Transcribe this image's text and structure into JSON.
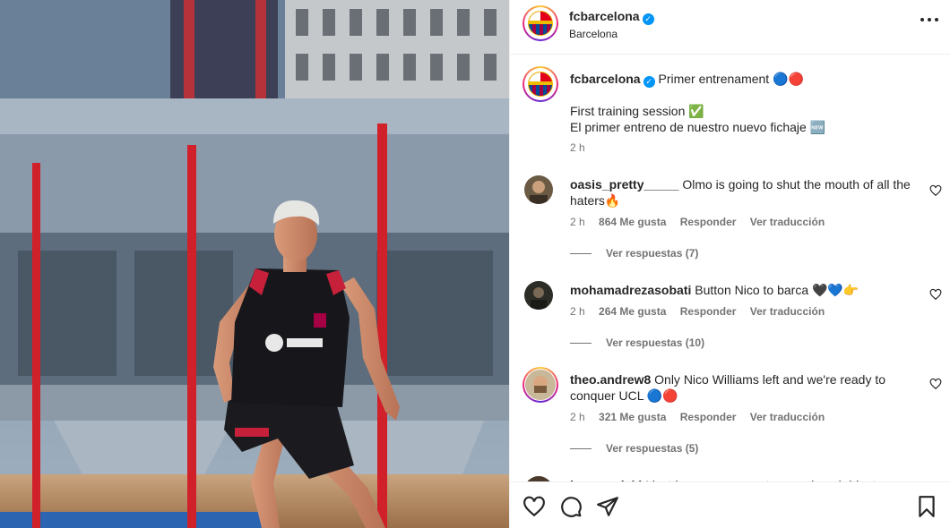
{
  "post": {
    "account": "fcbarcelona",
    "verified_mark": "✓",
    "location": "Barcelona",
    "photo_subject": "player-training-photo"
  },
  "caption": {
    "username": "fcbarcelona",
    "title": "Primer entrenament 🔵🔴",
    "line1": "First training session ✅",
    "line2": "El primer entreno de nuestro nuevo fichaje 🆕",
    "time": "2 h"
  },
  "comments": [
    {
      "username": "oasis_pretty_____",
      "text": "Olmo is going to shut the mouth of all the haters🔥",
      "time": "2 h",
      "likes": "864 Me gusta",
      "reply": "Responder",
      "translate": "Ver traducción",
      "replies": "Ver respuestas (7)"
    },
    {
      "username": "mohamadrezasobati",
      "text": "Button Nico to barca 🖤💙👉",
      "time": "2 h",
      "likes": "264 Me gusta",
      "reply": "Responder",
      "translate": "Ver traducción",
      "replies": "Ver respuestas (10)"
    },
    {
      "username": "theo.andrew8",
      "text": "Only Nico Williams left and we're ready to conquer UCL 🔵🔴",
      "time": "2 h",
      "likes": "321 Me gusta",
      "reply": "Responder",
      "translate": "Ver traducción",
      "replies": "Ver respuestas (5)"
    },
    {
      "username": "iam_madaki",
      "text": "I just hope you are not gonna bench him truna"
    }
  ],
  "icons": {
    "more": "more-options-icon",
    "like": "heart-icon",
    "comment": "comment-icon",
    "share": "share-icon",
    "save": "bookmark-icon"
  },
  "colors": {
    "verified": "#0095f6",
    "club_blue": "#004d98",
    "club_garnet": "#a50044",
    "pole_red": "#d0202a"
  }
}
